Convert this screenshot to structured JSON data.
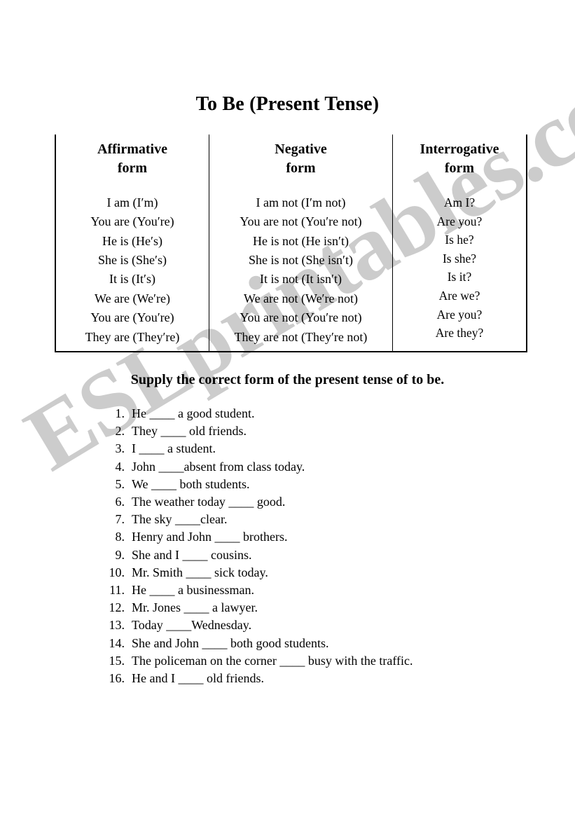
{
  "document": {
    "title": "To Be (Present Tense)",
    "watermark": "ESLprintables.com"
  },
  "table": {
    "columns": [
      {
        "header_line1": "Affirmative",
        "header_line2": "form",
        "rows": [
          "I am (I′m)",
          "You are (You′re)",
          "He is (He′s)",
          "She is (She′s)",
          "It is (It′s)",
          "We are (We′re)",
          "You are (You′re)",
          "They are (They′re)"
        ]
      },
      {
        "header_line1": "Negative",
        "header_line2": "form",
        "rows": [
          "I am not (I′m not)",
          "You are not (You′re not)",
          "He is not (He isn′t)",
          "She is not (She isn′t)",
          "It is not (It isn′t)",
          "We are not (We′re not)",
          "You are not (You′re not)",
          "They are not (They′re not)"
        ]
      },
      {
        "header_line1": "Interrogative",
        "header_line2": "form",
        "rows": [
          "Am I?",
          "Are you?",
          "Is he?",
          "Is she?",
          "Is it?",
          "Are we?",
          "Are you?",
          "Are they?"
        ]
      }
    ]
  },
  "exercise": {
    "instruction": "Supply the correct form of the present tense of to be.",
    "items": [
      {
        "number": "1.",
        "text": "He ____ a good student."
      },
      {
        "number": "2.",
        "text": "They ____ old friends."
      },
      {
        "number": "3.",
        "text": "I ____ a student."
      },
      {
        "number": "4.",
        "text": "John ____absent from class today."
      },
      {
        "number": "5.",
        "text": "We ____ both students."
      },
      {
        "number": "6.",
        "text": "The weather today ____ good."
      },
      {
        "number": "7.",
        "text": "The sky ____clear."
      },
      {
        "number": "8.",
        "text": "Henry and John ____ brothers."
      },
      {
        "number": "9.",
        "text": "She and I ____ cousins."
      },
      {
        "number": "10.",
        "text": "Mr. Smith ____ sick today."
      },
      {
        "number": "11.",
        "text": "He ____ a businessman."
      },
      {
        "number": "12.",
        "text": "Mr. Jones ____ a lawyer."
      },
      {
        "number": "13.",
        "text": "Today ____Wednesday."
      },
      {
        "number": "14.",
        "text": "She and John ____ both good students."
      },
      {
        "number": "15.",
        "text": "The policeman on the corner ____ busy with the traffic."
      },
      {
        "number": "16.",
        "text": "He and I ____ old friends."
      }
    ]
  },
  "colors": {
    "text": "#000000",
    "watermark": "#c8c8c8",
    "page_background": "#ffffff",
    "table_border": "#000000"
  }
}
